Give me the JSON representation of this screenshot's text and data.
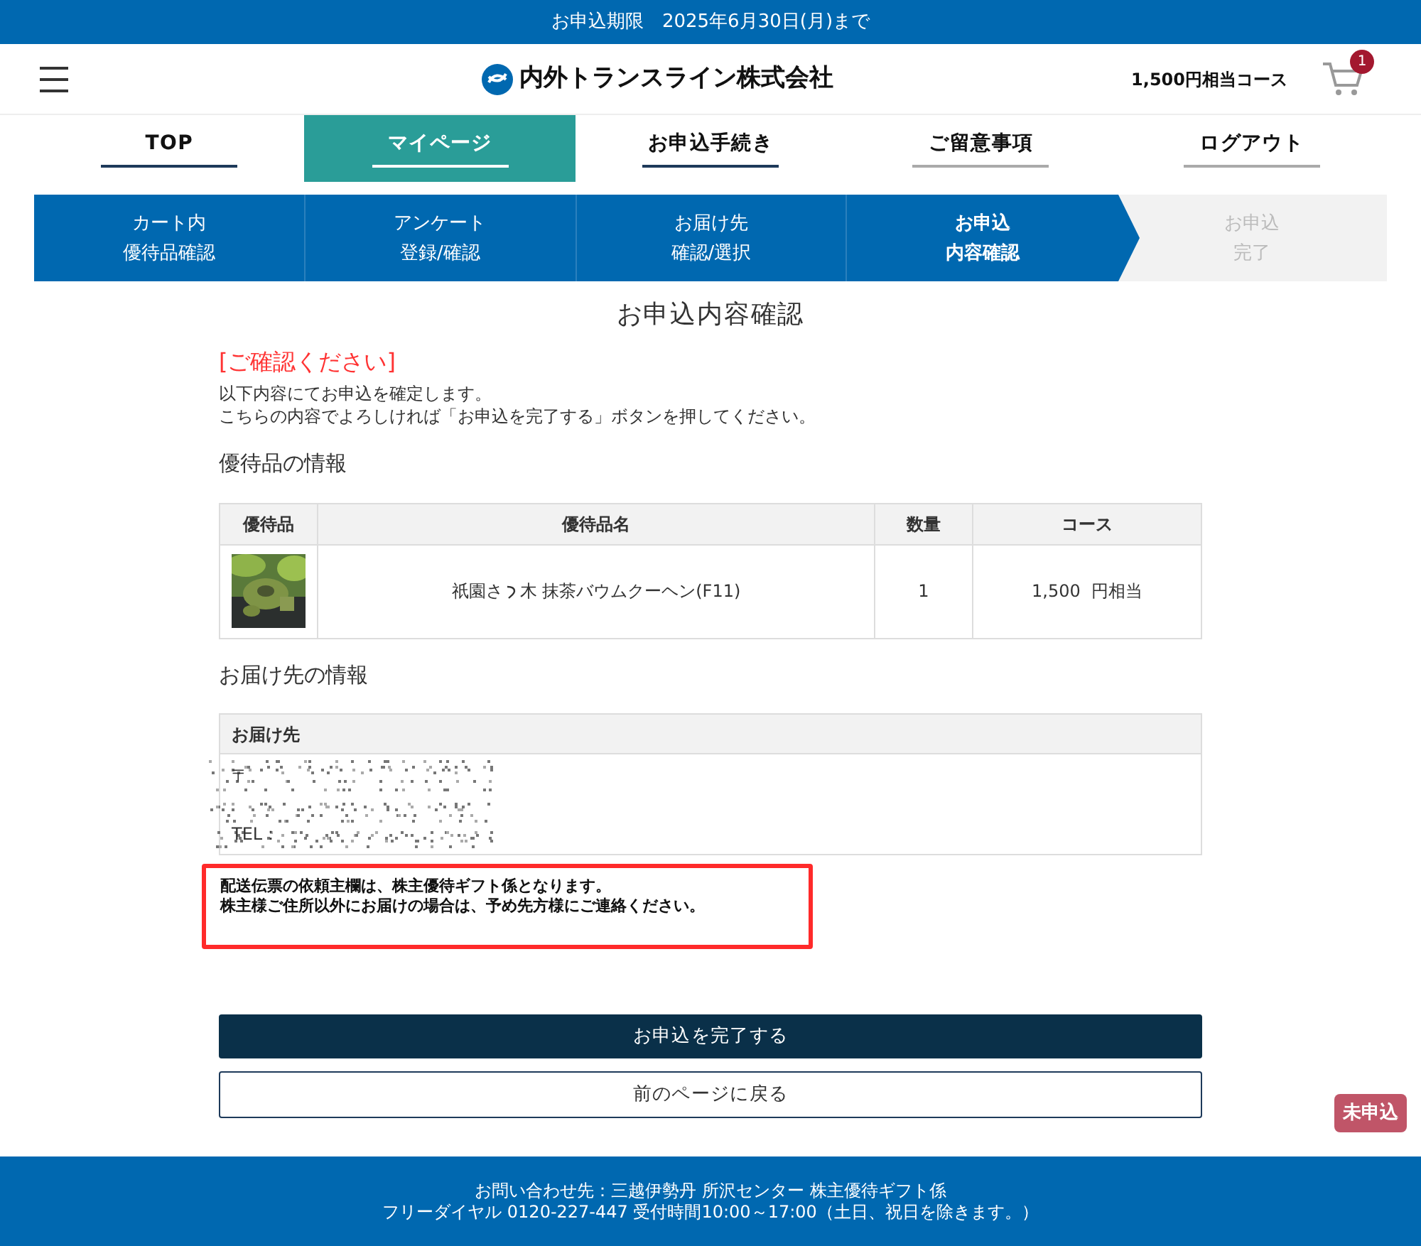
{
  "deadline_bar": "お申込期限　2025年6月30日(月)まで",
  "header": {
    "company": "内外トランスライン株式会社",
    "course": "1,500円相当コース",
    "cart_count": "1"
  },
  "nav": [
    {
      "label": "TOP",
      "selected": false,
      "color": "#1e3a5a"
    },
    {
      "label": "マイページ",
      "selected": true,
      "color": "#ffffff"
    },
    {
      "label": "お申込手続き",
      "selected": false,
      "color": "#1e3a5a"
    },
    {
      "label": "ご留意事項",
      "selected": false,
      "color": "#aaaaaa"
    },
    {
      "label": "ログアウト",
      "selected": false,
      "color": "#aaaaaa"
    }
  ],
  "steps": [
    {
      "lines": [
        "カート内",
        "優待品確認"
      ],
      "kind": "done"
    },
    {
      "lines": [
        "アンケート",
        "登録/確認"
      ],
      "kind": "done"
    },
    {
      "lines": [
        "お届け先",
        "確認/選択"
      ],
      "kind": "done"
    },
    {
      "lines": [
        "お申込",
        "内容確認"
      ],
      "kind": "current"
    },
    {
      "lines": [
        "お申込",
        "完了"
      ],
      "kind": "todo"
    }
  ],
  "page_title": "お申込内容確認",
  "notice_heading": "[ご確認ください]",
  "notice_lines": [
    "以下内容にてお申込を確定します。",
    "こちらの内容でよろしければ「お申込を完了する」ボタンを押してください。"
  ],
  "items_heading": "優待品の情報",
  "items_table": {
    "columns": [
      "優待品",
      "優待品名",
      "数量",
      "コース"
    ],
    "rows": [
      {
        "name_before_mark": "祇園さ",
        "name_after_mark": "木 抹茶バウムクーヘン(F11)",
        "quantity": "1",
        "course": "1,500  円相当"
      }
    ]
  },
  "delivery_heading": "お届け先の情報",
  "delivery_table": {
    "header": "お届け先",
    "lines": [
      "〒",
      "TEL："
    ]
  },
  "warning_lines": [
    "配送伝票の依頼主欄は、株主優待ギフト係となります。",
    "株主様ご住所以外にお届けの場合は、予め先方様にご連絡ください。"
  ],
  "buttons": {
    "submit": "お申込を完了する",
    "back": "前のページに戻る"
  },
  "status_badge": "未申込",
  "footer": [
    "お問い合わせ先：三越伊勢丹 所沢センター 株主優待ギフト係",
    "フリーダイヤル 0120-227-447 受付時間10:00～17:00（土日、祝日を除きます。）"
  ]
}
